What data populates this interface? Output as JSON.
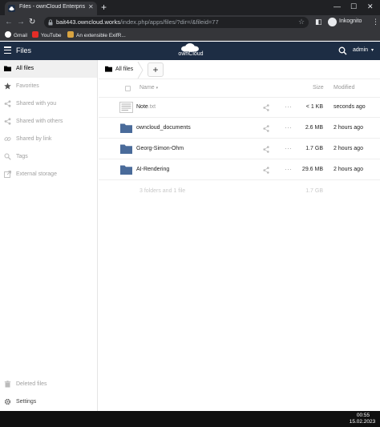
{
  "browser": {
    "tab_title": "Files - ownCloud Enterprise Editi",
    "tab_close": "✕",
    "new_tab": "+",
    "window_controls": [
      "—",
      "☐",
      "✕"
    ],
    "url_host": "bait443.owncloud.works",
    "url_path": "/index.php/apps/files/?dir=/&fileid=77",
    "profile_label": "Inkognito",
    "bookmarks": [
      {
        "label": "Gmail",
        "icon": "google-icon"
      },
      {
        "label": "YouTube",
        "icon": "youtube-icon"
      },
      {
        "label": "An extensible ExifR...",
        "icon": "bookmark-page-icon"
      }
    ]
  },
  "header": {
    "app_name": "Files",
    "logo_text": "ownCloud",
    "user": "admin",
    "caret": "▾"
  },
  "sidebar": {
    "items": [
      {
        "label": "All files",
        "icon": "folder-icon",
        "active": true
      },
      {
        "label": "Favorites",
        "icon": "star-icon"
      },
      {
        "label": "Shared with you",
        "icon": "share-icon"
      },
      {
        "label": "Shared with others",
        "icon": "share-icon"
      },
      {
        "label": "Shared by link",
        "icon": "link-icon"
      },
      {
        "label": "Tags",
        "icon": "tag-icon"
      },
      {
        "label": "External storage",
        "icon": "external-storage-icon"
      }
    ],
    "bottom": [
      {
        "label": "Deleted files",
        "icon": "trash-icon"
      },
      {
        "label": "Settings",
        "icon": "gear-icon"
      }
    ]
  },
  "breadcrumb": {
    "label": "All files",
    "new_button": "+"
  },
  "table": {
    "columns": {
      "name": "Name",
      "sort_indicator": "▾",
      "size": "Size",
      "modified": "Modified"
    },
    "rows": [
      {
        "name": "Note",
        "ext": ".txt",
        "type": "text-file-icon",
        "more": "···",
        "size": "< 1 KB",
        "modified": "seconds ago"
      },
      {
        "name": "owncloud_documents",
        "ext": "",
        "type": "folder-icon",
        "more": "···",
        "size": "2.6 MB",
        "modified": "2 hours ago"
      },
      {
        "name": "Georg-Simon-Ohm",
        "ext": "",
        "type": "folder-icon",
        "more": "···",
        "size": "1.7 GB",
        "modified": "2 hours ago"
      },
      {
        "name": "AI-Rendering",
        "ext": "",
        "type": "folder-icon",
        "more": "···",
        "size": "29.6 MB",
        "modified": "2 hours ago"
      }
    ],
    "summary": {
      "text": "3 folders and 1 file",
      "size": "1.7 GB"
    }
  },
  "taskbar": {
    "time": "00:55",
    "date": "15.02.2023"
  },
  "colors": {
    "header": "#1d2d44",
    "folder": "#4a6b9a",
    "chrome_dark": "#202124",
    "chrome_mid": "#35363a"
  }
}
